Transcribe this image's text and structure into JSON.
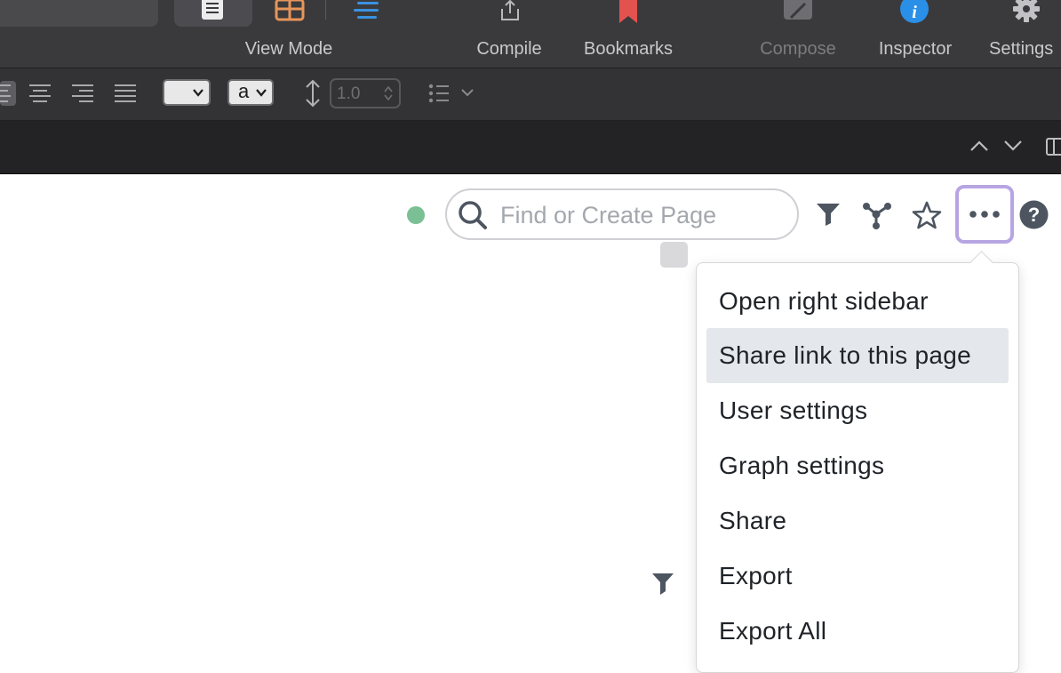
{
  "toolbar": {
    "view_mode_label": "View Mode",
    "compile_label": "Compile",
    "bookmarks_label": "Bookmarks",
    "compose_label": "Compose",
    "inspector_label": "Inspector",
    "settings_label": "Settings"
  },
  "formatbar": {
    "style_select_value": "a",
    "line_spacing_value": "1.0"
  },
  "search": {
    "placeholder": "Find or Create Page"
  },
  "menu": {
    "items": [
      "Open right sidebar",
      "Share link to this page",
      "User settings",
      "Graph settings",
      "Share",
      "Export",
      "Export All"
    ],
    "highlighted": "Share link to this page"
  },
  "colors": {
    "status_dot": "#7bbf94",
    "menu_button_ring": "#b7a5e3",
    "bookmark_red": "#e2524f",
    "inspector_blue": "#2a8fe6",
    "gridview_orange": "#e8955a"
  },
  "icons": [
    "document-icon",
    "grid-icon",
    "outline-icon",
    "share-export-icon",
    "bookmark-icon",
    "compose-icon",
    "info-icon",
    "gear-icon",
    "align-left-icon",
    "align-center-icon",
    "align-right-icon",
    "justify-icon",
    "line-spacing-icon",
    "list-icon",
    "chevron-down-icon",
    "chevron-up-icon",
    "split-view-icon",
    "search-icon",
    "filter-icon",
    "graph-icon",
    "star-icon",
    "more-icon",
    "help-icon"
  ]
}
